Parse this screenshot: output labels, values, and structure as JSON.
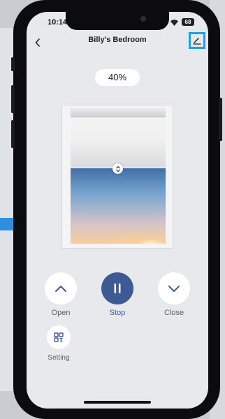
{
  "status_bar": {
    "time": "10:14",
    "battery": "68"
  },
  "header": {
    "title": "Billy's Bedroom"
  },
  "blind": {
    "position_label": "40%",
    "position_value": 40
  },
  "controls": {
    "open_label": "Open",
    "stop_label": "Stop",
    "close_label": "Close",
    "setting_label": "Setting"
  },
  "colors": {
    "accent": "#3e5a94",
    "highlight": "#1f9fe6"
  },
  "icons": {
    "back": "chevron-left-icon",
    "edit": "edit-icon",
    "open": "chevron-up-icon",
    "stop": "pause-icon",
    "close": "chevron-down-icon",
    "setting": "grid-icon",
    "handle": "drag-handle-icon"
  }
}
